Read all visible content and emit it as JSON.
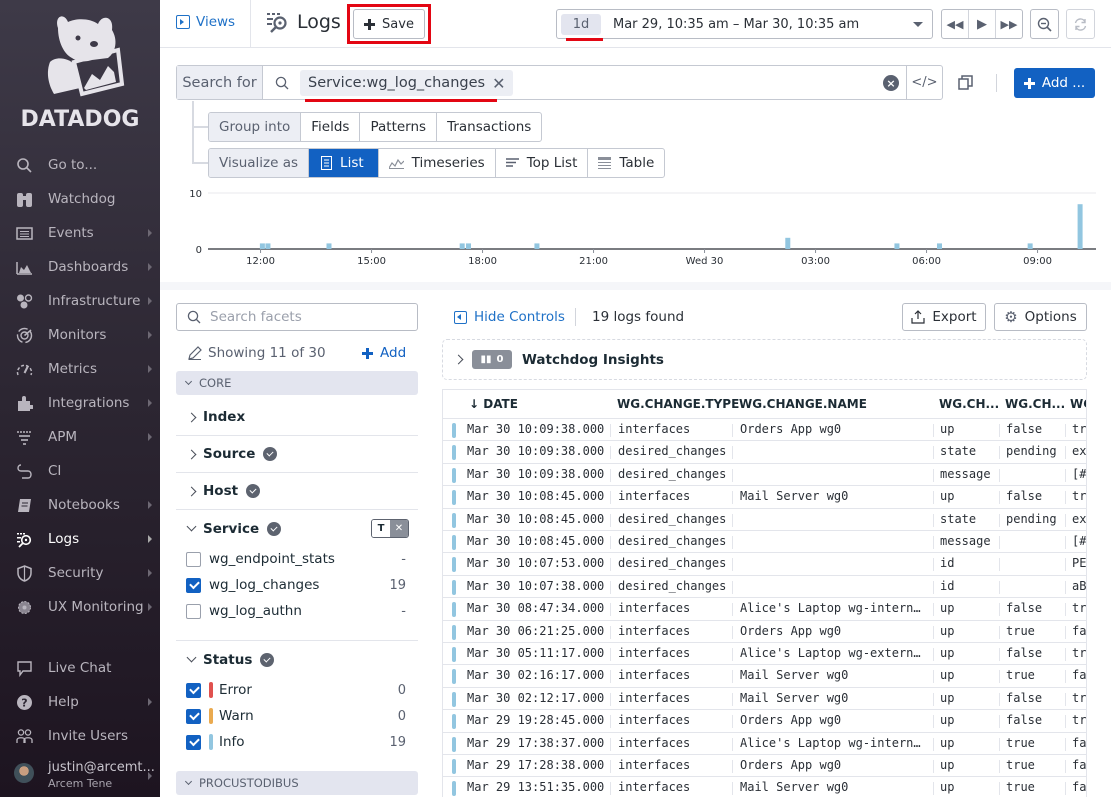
{
  "sidebar": {
    "brand": "DATADOG",
    "items": [
      {
        "label": "Go to...",
        "icon": "search-icon",
        "arrow": false
      },
      {
        "label": "Watchdog",
        "icon": "binoculars-icon",
        "arrow": false
      },
      {
        "label": "Events",
        "icon": "events-icon",
        "arrow": true
      },
      {
        "label": "Dashboards",
        "icon": "dashboards-icon",
        "arrow": true
      },
      {
        "label": "Infrastructure",
        "icon": "infrastructure-icon",
        "arrow": true
      },
      {
        "label": "Monitors",
        "icon": "monitors-icon",
        "arrow": true
      },
      {
        "label": "Metrics",
        "icon": "metrics-icon",
        "arrow": true
      },
      {
        "label": "Integrations",
        "icon": "puzzle-icon",
        "arrow": true
      },
      {
        "label": "APM",
        "icon": "apm-icon",
        "arrow": true
      },
      {
        "label": "CI",
        "icon": "ci-icon",
        "arrow": false
      },
      {
        "label": "Notebooks",
        "icon": "notebook-icon",
        "arrow": true
      },
      {
        "label": "Logs",
        "icon": "logs-icon",
        "arrow": true,
        "active": true
      },
      {
        "label": "Security",
        "icon": "shield-icon",
        "arrow": true
      },
      {
        "label": "UX Monitoring",
        "icon": "globe-icon",
        "arrow": true
      }
    ],
    "bottom_items": [
      {
        "label": "Live Chat",
        "icon": "chat-icon",
        "arrow": false
      },
      {
        "label": "Help",
        "icon": "help-icon",
        "arrow": true
      },
      {
        "label": "Invite Users",
        "icon": "users-icon",
        "arrow": false
      }
    ],
    "user": {
      "email": "justin@arcemt...",
      "org": "Arcem Tene"
    }
  },
  "topbar": {
    "views_label": "Views",
    "title": "Logs",
    "save_label": "Save",
    "time_pill": "1d",
    "time_range": "Mar 29, 10:35 am – Mar 30, 10:35 am"
  },
  "search": {
    "label": "Search for",
    "chip": "Service:wg_log_changes",
    "code_label": "</>",
    "add_label": "Add ..."
  },
  "group_into": {
    "label": "Group into",
    "options": [
      "Fields",
      "Patterns",
      "Transactions"
    ]
  },
  "visualize_as": {
    "label": "Visualize as",
    "options": [
      "List",
      "Timeseries",
      "Top List",
      "Table"
    ],
    "selected": "List"
  },
  "chart_data": {
    "type": "bar",
    "title": "",
    "xlabel": "",
    "ylabel": "",
    "ylim": [
      0,
      10
    ],
    "yticks": [
      "0",
      "10"
    ],
    "xticks": [
      "12:00",
      "15:00",
      "18:00",
      "21:00",
      "Wed 30",
      "03:00",
      "06:00",
      "09:00"
    ],
    "x_hours_from_1035_mar29": true,
    "bars": [
      {
        "t": 12.05,
        "value": 1
      },
      {
        "t": 12.2,
        "value": 1
      },
      {
        "t": 13.85,
        "value": 1
      },
      {
        "t": 17.45,
        "value": 1
      },
      {
        "t": 17.62,
        "value": 1
      },
      {
        "t": 19.47,
        "value": 1
      },
      {
        "t": 26.25,
        "value": 2
      },
      {
        "t": 29.2,
        "value": 1
      },
      {
        "t": 30.35,
        "value": 1
      },
      {
        "t": 32.8,
        "value": 1
      },
      {
        "t": 34.15,
        "value": 8
      }
    ],
    "color": "#92c6e0"
  },
  "facets": {
    "search_placeholder": "Search facets",
    "showing": "Showing 11 of 30",
    "add_label": "Add",
    "core_label": "CORE",
    "groups": [
      {
        "label": "Index",
        "verified": false
      },
      {
        "label": "Source",
        "verified": true
      },
      {
        "label": "Host",
        "verified": true
      },
      {
        "label": "Service",
        "verified": true
      }
    ],
    "service_values": [
      {
        "label": "wg_endpoint_stats",
        "count": "-",
        "checked": false
      },
      {
        "label": "wg_log_changes",
        "count": "19",
        "checked": true
      },
      {
        "label": "wg_log_authn",
        "count": "-",
        "checked": false
      }
    ],
    "status_label": "Status",
    "status_values": [
      {
        "label": "Error",
        "count": "0",
        "checked": true,
        "color": "#e0514e"
      },
      {
        "label": "Warn",
        "count": "0",
        "checked": true,
        "color": "#eaaa4f"
      },
      {
        "label": "Info",
        "count": "19",
        "checked": true,
        "color": "#92c6e0"
      }
    ],
    "procustodibus_label": "PROCUSTODIBUS"
  },
  "logs": {
    "hide_controls": "Hide Controls",
    "found": "19 logs found",
    "export_label": "Export",
    "options_label": "Options",
    "watchdog_label": "Watchdog Insights",
    "watchdog_count": "0",
    "columns": [
      "DATE",
      "WG.CHANGE.TYPE",
      "WG.CHANGE.NAME",
      "WG.CH...",
      "WG.CH...",
      "WG"
    ],
    "rows": [
      [
        "Mar 30 10:09:38.000",
        "interfaces",
        "Orders App wg0",
        "up",
        "false",
        "tr"
      ],
      [
        "Mar 30 10:09:38.000",
        "desired_changes",
        "",
        "state",
        "pending",
        "ex"
      ],
      [
        "Mar 30 10:09:38.000",
        "desired_changes",
        "",
        "message",
        "",
        "[#"
      ],
      [
        "Mar 30 10:08:45.000",
        "interfaces",
        "Mail Server wg0",
        "up",
        "false",
        "tr"
      ],
      [
        "Mar 30 10:08:45.000",
        "desired_changes",
        "",
        "state",
        "pending",
        "ex"
      ],
      [
        "Mar 30 10:08:45.000",
        "desired_changes",
        "",
        "message",
        "",
        "[#"
      ],
      [
        "Mar 30 10:07:53.000",
        "desired_changes",
        "",
        "id",
        "",
        "PE"
      ],
      [
        "Mar 30 10:07:38.000",
        "desired_changes",
        "",
        "id",
        "",
        "aB"
      ],
      [
        "Mar 30 08:47:34.000",
        "interfaces",
        "Alice's Laptop wg-intern…",
        "up",
        "false",
        "tr"
      ],
      [
        "Mar 30 06:21:25.000",
        "interfaces",
        "Orders App wg0",
        "up",
        "true",
        "fa"
      ],
      [
        "Mar 30 05:11:17.000",
        "interfaces",
        "Alice's Laptop wg-extern…",
        "up",
        "false",
        "tr"
      ],
      [
        "Mar 30 02:16:17.000",
        "interfaces",
        "Mail Server wg0",
        "up",
        "true",
        "fa"
      ],
      [
        "Mar 30 02:12:17.000",
        "interfaces",
        "Mail Server wg0",
        "up",
        "false",
        "tr"
      ],
      [
        "Mar 29 19:28:45.000",
        "interfaces",
        "Orders App wg0",
        "up",
        "false",
        "tr"
      ],
      [
        "Mar 29 17:38:37.000",
        "interfaces",
        "Alice's Laptop wg-intern…",
        "up",
        "true",
        "fa"
      ],
      [
        "Mar 29 17:28:38.000",
        "interfaces",
        "Orders App wg0",
        "up",
        "true",
        "fa"
      ],
      [
        "Mar 29 13:51:35.000",
        "interfaces",
        "Mail Server wg0",
        "up",
        "true",
        "fa"
      ]
    ]
  }
}
